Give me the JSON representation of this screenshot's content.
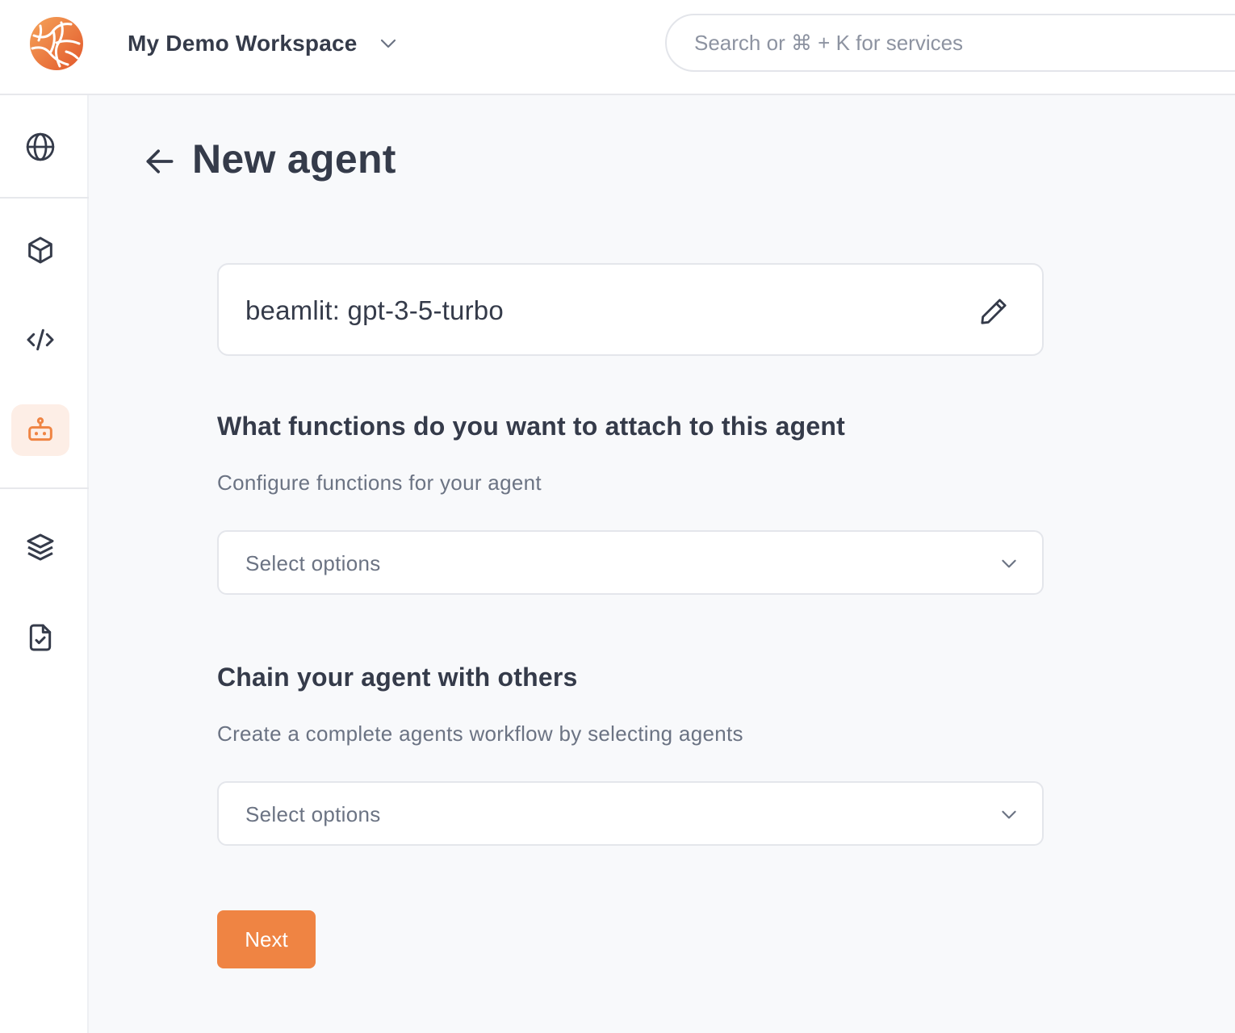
{
  "header": {
    "workspace_name": "My Demo Workspace",
    "search_placeholder": "Search or ⌘ + K for services"
  },
  "sidebar": {
    "items": [
      {
        "icon": "globe-icon"
      },
      {
        "icon": "cube-icon"
      },
      {
        "icon": "code-icon"
      },
      {
        "icon": "robot-icon",
        "active": true
      },
      {
        "icon": "layers-icon"
      },
      {
        "icon": "file-check-icon"
      }
    ]
  },
  "page": {
    "title": "New agent"
  },
  "model": {
    "name": "beamlit: gpt-3-5-turbo"
  },
  "functions_section": {
    "title": "What functions do you want to attach to this agent",
    "subtitle": "Configure functions for your agent",
    "placeholder": "Select options"
  },
  "chain_section": {
    "title": "Chain your agent with others",
    "subtitle": "Create a complete agents workflow by selecting agents",
    "placeholder": "Select options"
  },
  "actions": {
    "next_label": "Next"
  },
  "colors": {
    "accent": "#ef8443",
    "active_bg": "#fdeee6",
    "text": "#353b4a",
    "muted": "#6b7383"
  }
}
